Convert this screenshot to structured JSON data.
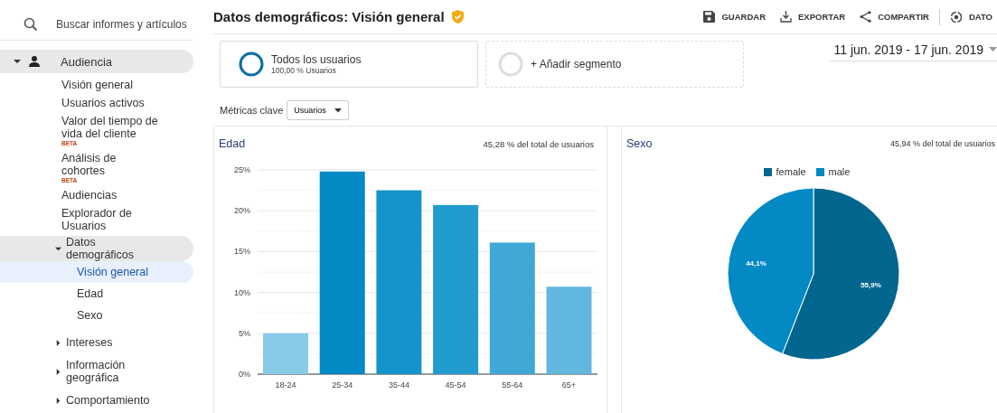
{
  "sidebar": {
    "search": {
      "placeholder": "Buscar informes y artículos"
    },
    "items": [
      {
        "label": "Audiencia",
        "expanded": true,
        "selected": false,
        "children": [
          {
            "label": "Visión general",
            "selected": false
          },
          {
            "label": "Usuarios activos",
            "selected": false
          },
          {
            "label": "Valor del tiempo de vida del cliente",
            "badge": "BETA",
            "selected": false
          },
          {
            "label": "Análisis de cohortes",
            "badge": "BETA",
            "selected": false
          },
          {
            "label": "Audiencias",
            "selected": false
          },
          {
            "label": "Explorador de Usuarios",
            "selected": false
          },
          {
            "label": "Datos demográficos",
            "expanded": true,
            "selected": false,
            "children": [
              {
                "label": "Visión general",
                "selected": true
              },
              {
                "label": "Edad",
                "selected": false
              },
              {
                "label": "Sexo",
                "selected": false
              }
            ]
          },
          {
            "label": "Intereses",
            "expanded": false,
            "selected": false
          },
          {
            "label": "Información geográfica",
            "expanded": false,
            "selected": false
          },
          {
            "label": "Comportamiento",
            "expanded": false,
            "selected": false
          }
        ]
      }
    ]
  },
  "header": {
    "title": "Datos demográficos: Visión general",
    "actions": [
      {
        "kind": "save",
        "label": "GUARDAR"
      },
      {
        "kind": "export",
        "label": "EXPORTAR"
      },
      {
        "kind": "share",
        "label": "COMPARTIR"
      },
      {
        "kind": "insights",
        "label": "DATO"
      }
    ]
  },
  "segments": [
    {
      "kind": "segment",
      "name": "Todos los usuarios",
      "detail": "100,00 % Usuarios"
    },
    {
      "kind": "add",
      "name": "+ Añadir segmento"
    }
  ],
  "date_range": "11 jun. 2019 - 17 jun. 2019",
  "metrics": {
    "label": "Métricas clave",
    "value": "Usuarios"
  },
  "panels": [
    {
      "title": "Edad",
      "total": "45,28 % del total de usuarios",
      "chart_data": {
        "type": "bar",
        "categories": [
          "18-24",
          "25-34",
          "35-44",
          "45-54",
          "55-64",
          "65+"
        ],
        "series": [
          {
            "values": [
              5.0,
              24.8,
              22.5,
              20.7,
              16.1,
              10.7
            ]
          }
        ],
        "colors": [
          "#87cbe8",
          "#0389c4",
          "#1594cb",
          "#229bcf",
          "#40a8d6",
          "#62b7de"
        ],
        "grid": true,
        "ylim": [
          0,
          25
        ],
        "yticks": [
          {
            "value": 0,
            "label": "0%"
          },
          {
            "value": 5,
            "label": "5%"
          },
          {
            "value": 10,
            "label": "10%"
          },
          {
            "value": 15,
            "label": "15%"
          },
          {
            "value": 20,
            "label": "20%"
          },
          {
            "value": 25,
            "label": "25%"
          }
        ]
      }
    },
    {
      "title": "Sexo",
      "total": "45,94 % del total de usuarios",
      "chart_data": {
        "type": "pie",
        "categories": [
          "female",
          "male"
        ],
        "series": [
          {
            "values": [
              55.9,
              44.1
            ]
          }
        ],
        "colors": [
          "#03668f",
          "#0389c4"
        ],
        "legend": "top",
        "value_labels": [
          "55,9%",
          "44,1%"
        ]
      }
    }
  ]
}
